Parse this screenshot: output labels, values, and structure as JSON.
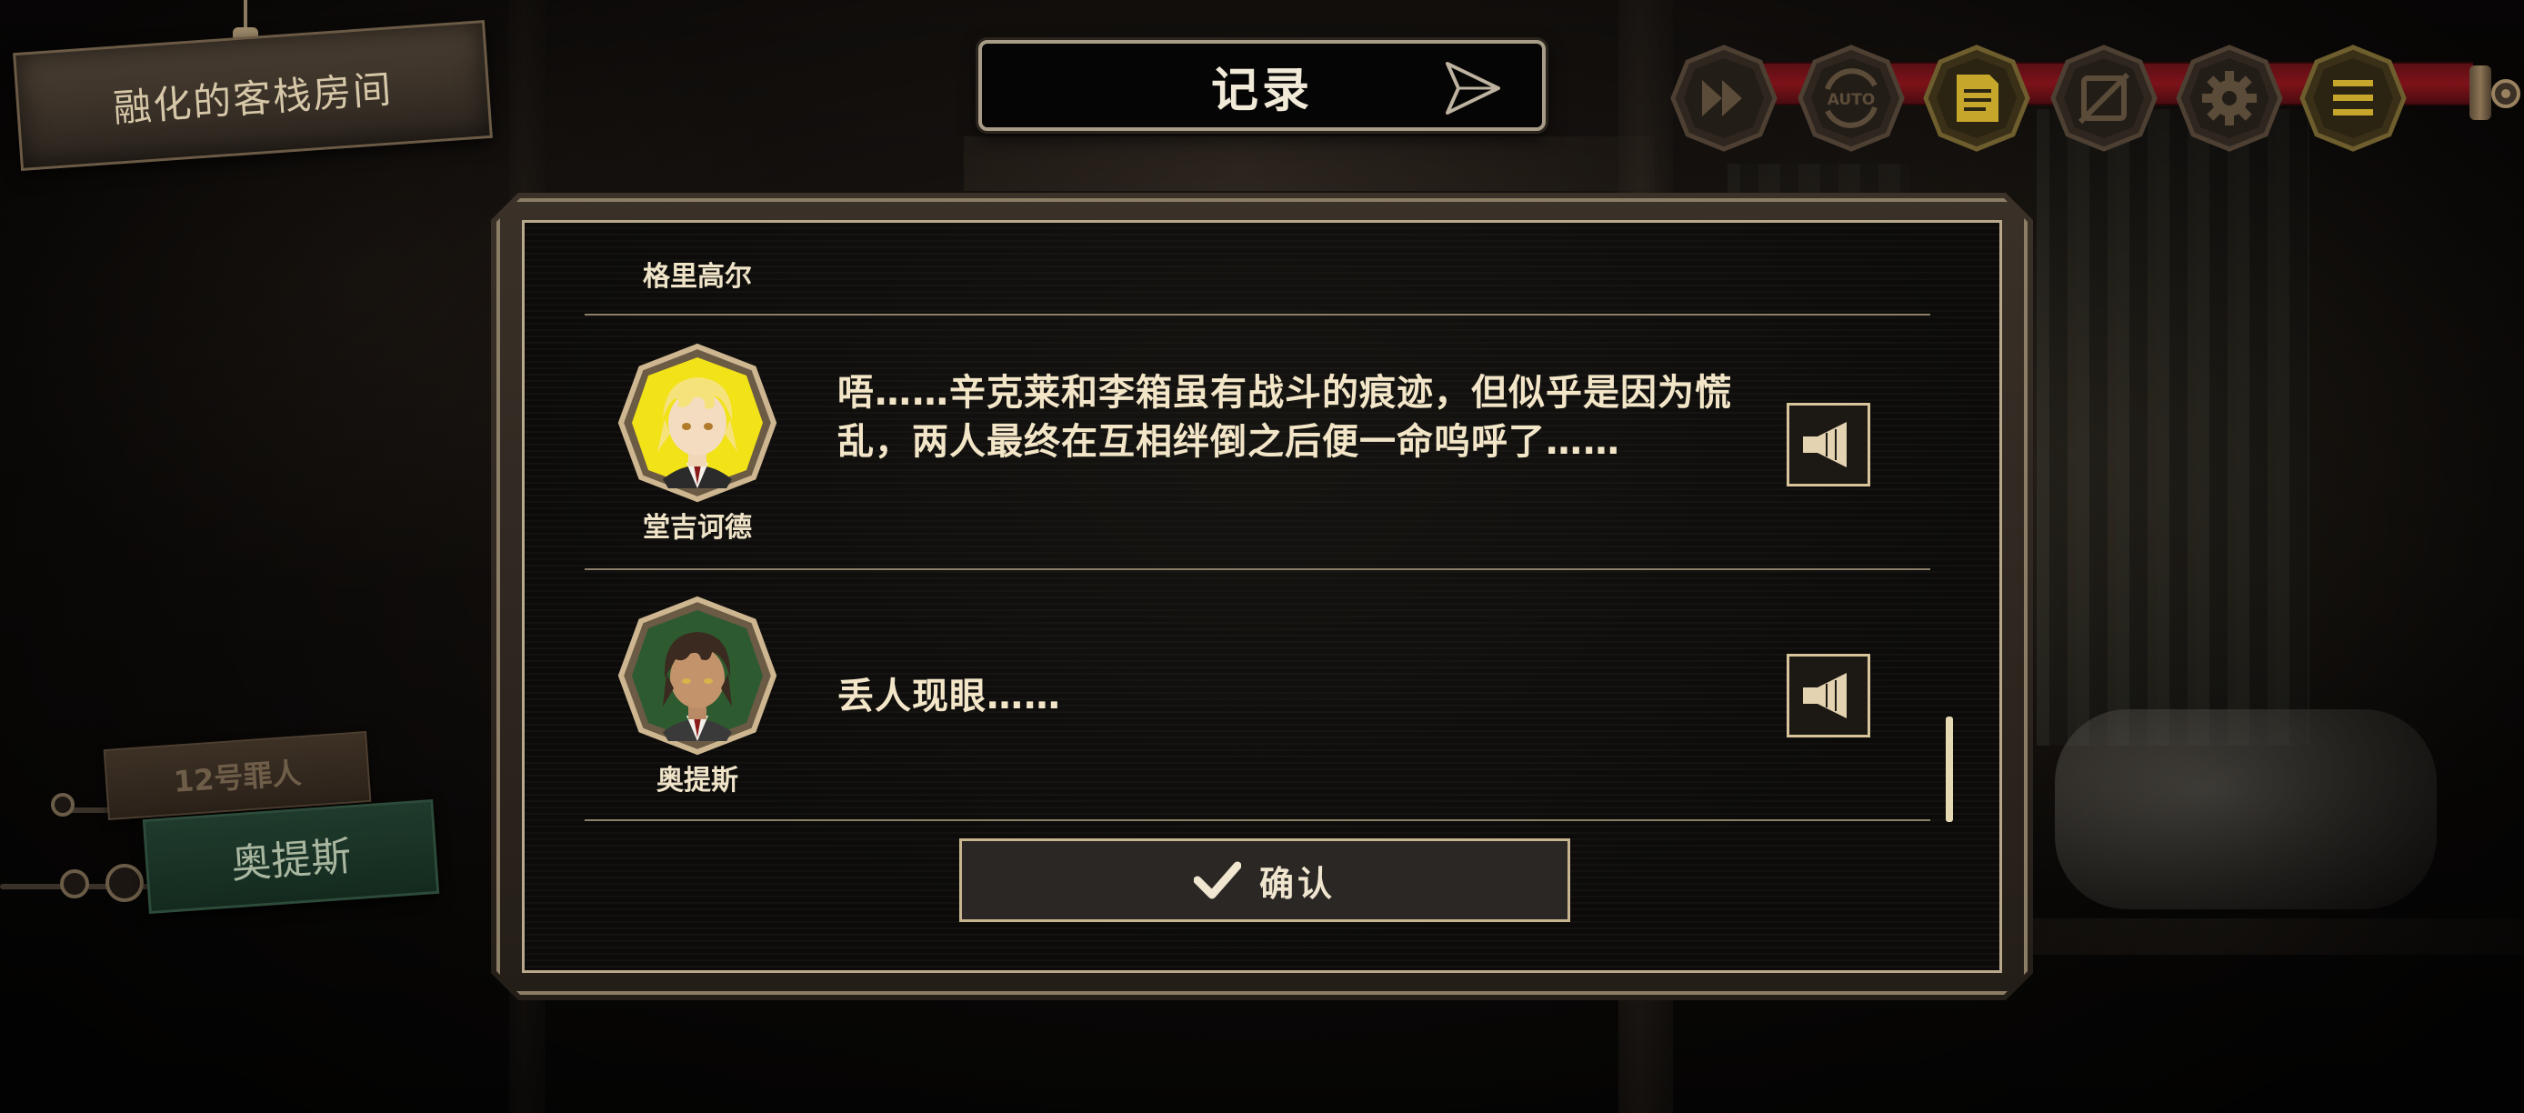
{
  "location": {
    "label": "融化的客栈房间"
  },
  "log_window": {
    "title": "记录",
    "entries": [
      {
        "speaker": "格里高尔",
        "text": ""
      },
      {
        "speaker": "堂吉诃德",
        "text": "唔……辛克莱和李箱虽有战斗的痕迹，但似乎是因为慌乱，两人最终在互相绊倒之后便一命呜呼了……"
      },
      {
        "speaker": "奥提斯",
        "text": "丢人现眼……"
      }
    ],
    "confirm_label": "确认"
  },
  "toolbar": {
    "auto_label": "AUTO",
    "buttons": [
      "fast-forward-icon",
      "auto-play-icon",
      "log-icon",
      "hide-ui-icon",
      "settings-icon",
      "menu-icon"
    ]
  },
  "character": {
    "role": "12号罪人",
    "name": "奥提斯"
  },
  "colors": {
    "accent_gold": "#c7b590",
    "rail_red": "#7d1219",
    "name_plate_green": "#1f3b2c",
    "avatar_yellow": "#f2e218",
    "avatar_green": "#2e5a2f"
  }
}
